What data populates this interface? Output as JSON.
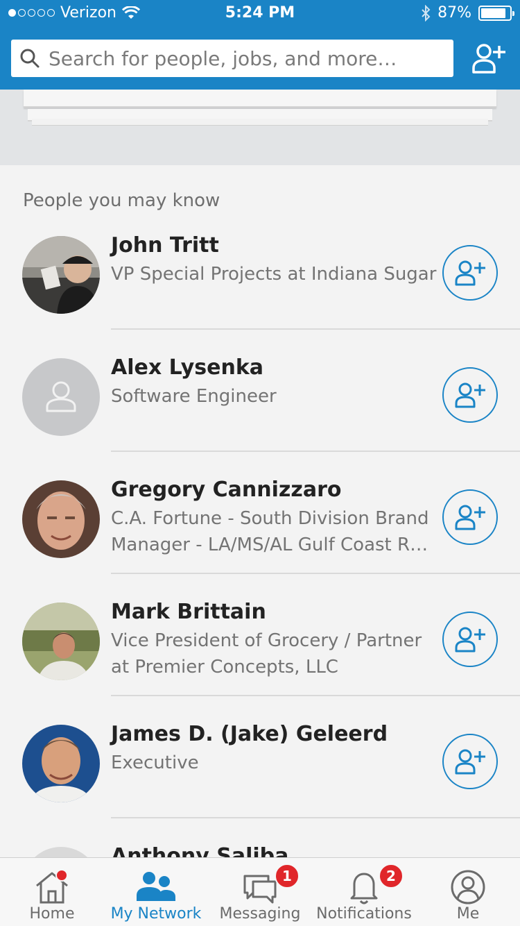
{
  "status_bar": {
    "carrier": "Verizon",
    "time": "5:24 PM",
    "battery": "87%",
    "battery_level": 0.87
  },
  "search": {
    "placeholder": "Search for people, jobs, and more…"
  },
  "section": {
    "title": "People you may know"
  },
  "people": [
    {
      "name": "John Tritt",
      "headline": "VP Special Projects at Indiana Sugars",
      "avatar": "photo"
    },
    {
      "name": "Alex Lysenka",
      "headline": "Software Engineer",
      "avatar": "placeholder"
    },
    {
      "name": "Gregory Cannizzaro",
      "headline": "C.A. Fortune - South Division Brand Manager - LA/MS/AL Gulf Coast R…",
      "avatar": "photo"
    },
    {
      "name": "Mark Brittain",
      "headline": "Vice President of Grocery / Partner at Premier Concepts, LLC",
      "avatar": "photo"
    },
    {
      "name": "James D. (Jake) Geleerd",
      "headline": "Executive",
      "avatar": "photo"
    },
    {
      "name": "Anthony Saliba",
      "headline": "",
      "avatar": "photo"
    }
  ],
  "tabs": [
    {
      "label": "Home",
      "icon": "home-icon",
      "active": false,
      "badge": "",
      "dot": true
    },
    {
      "label": "My Network",
      "icon": "network-icon",
      "active": true,
      "badge": "",
      "dot": false
    },
    {
      "label": "Messaging",
      "icon": "messaging-icon",
      "active": false,
      "badge": "1",
      "dot": false
    },
    {
      "label": "Notifications",
      "icon": "bell-icon",
      "active": false,
      "badge": "2",
      "dot": false
    },
    {
      "label": "Me",
      "icon": "profile-icon",
      "active": false,
      "badge": "",
      "dot": false
    }
  ],
  "colors": {
    "brand_blue": "#1a84c6",
    "badge_red": "#e0262a"
  }
}
